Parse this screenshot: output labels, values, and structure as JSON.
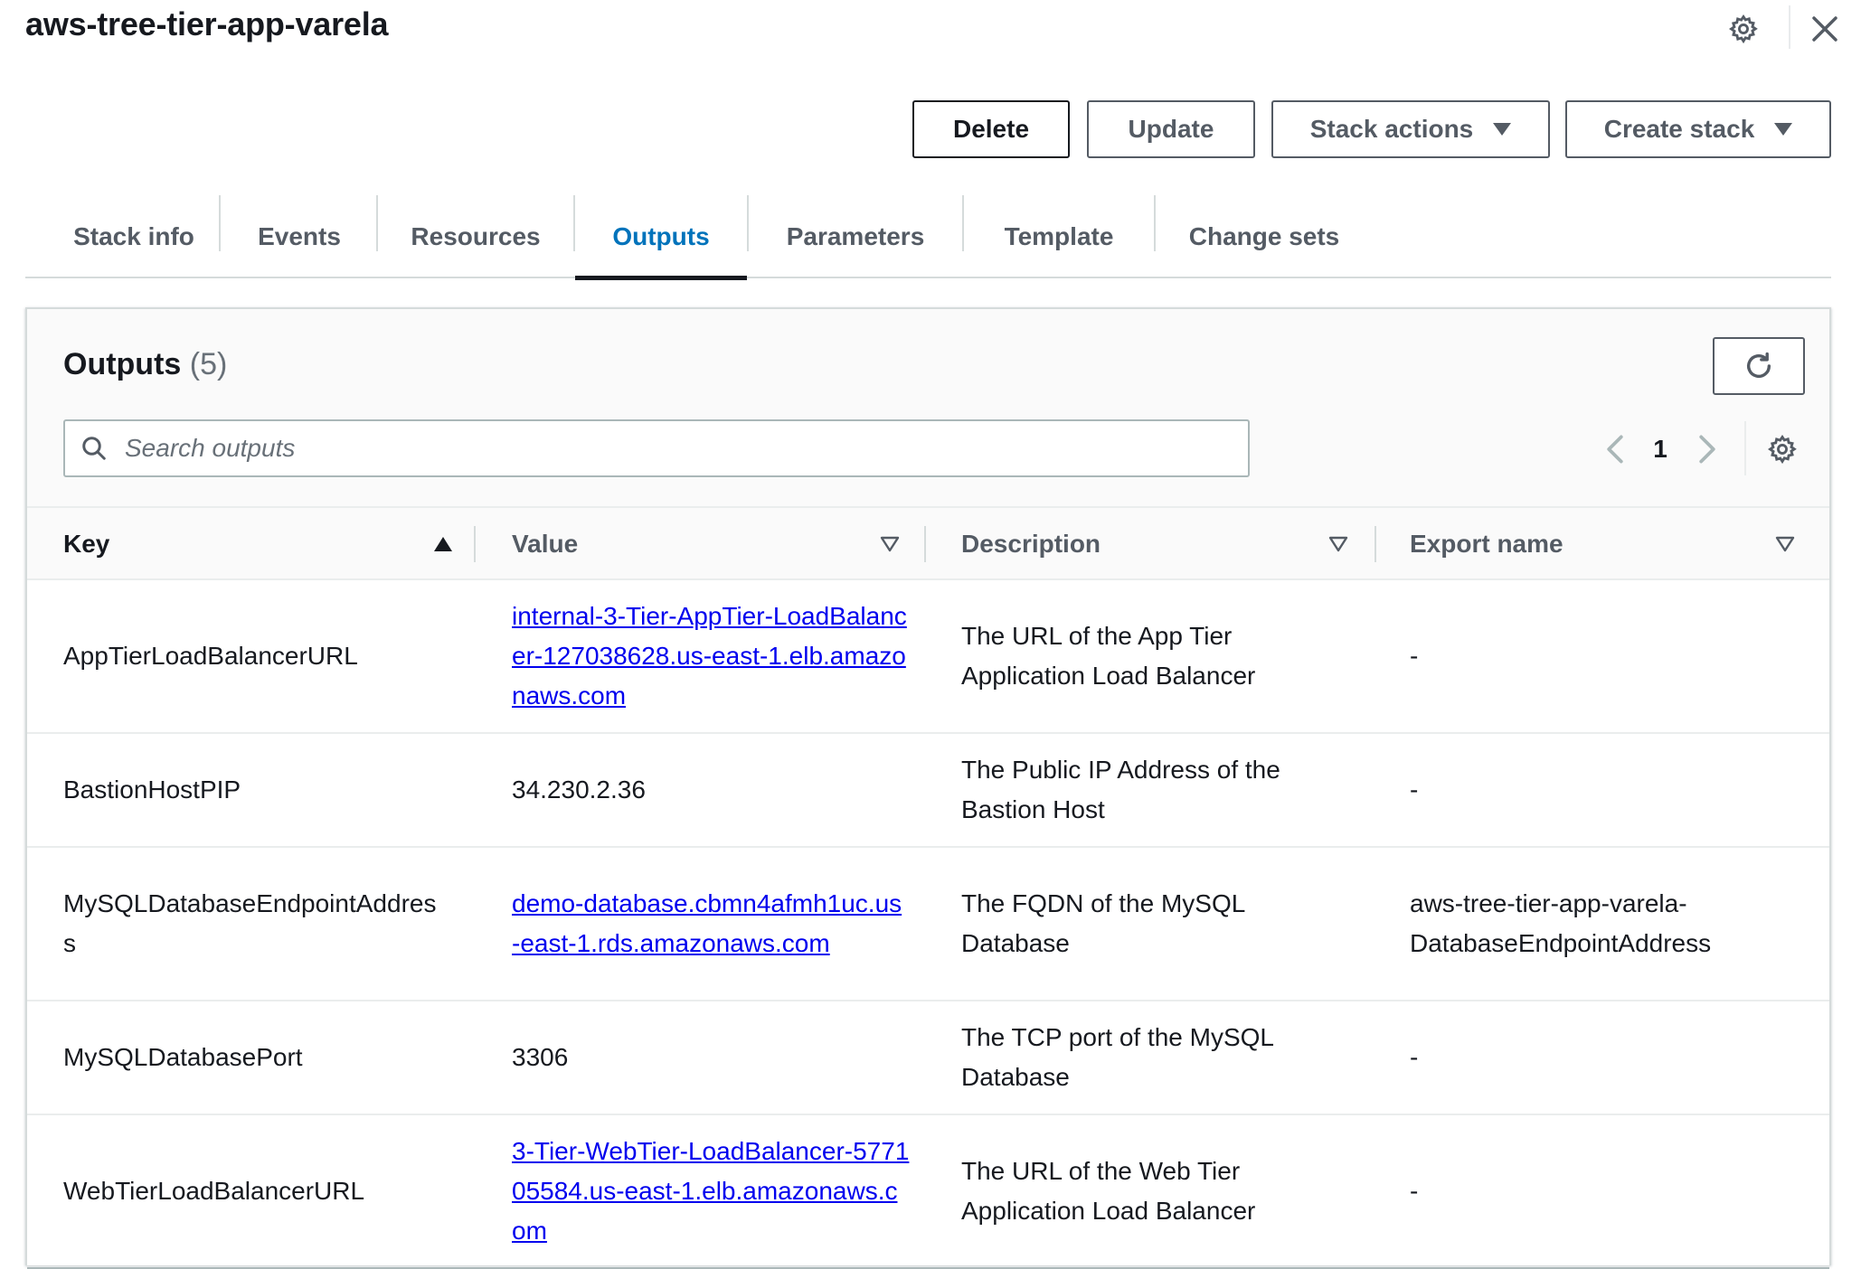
{
  "header": {
    "title": "aws-tree-tier-app-varela",
    "icons": [
      "gear-icon",
      "close-icon"
    ]
  },
  "actions": {
    "delete": "Delete",
    "update": "Update",
    "stack_actions": "Stack actions",
    "create_stack": "Create stack"
  },
  "tabs": [
    {
      "label": "Stack info"
    },
    {
      "label": "Events"
    },
    {
      "label": "Resources"
    },
    {
      "label": "Outputs",
      "active": true
    },
    {
      "label": "Parameters"
    },
    {
      "label": "Template"
    },
    {
      "label": "Change sets"
    }
  ],
  "outputs": {
    "title": "Outputs",
    "count": "(5)",
    "search_placeholder": "Search outputs",
    "search_value": "",
    "page": "1",
    "columns": {
      "key": "Key",
      "value": "Value",
      "description": "Description",
      "export_name": "Export name"
    },
    "sort": {
      "column": "Key",
      "direction": "ascending"
    },
    "rows": [
      {
        "key": "AppTierLoadBalancerURL",
        "value": "internal-3-Tier-AppTier-LoadBalancer-127038628.us-east-1.elb.amazonaws.com",
        "value_is_link": true,
        "description": "The URL of the App Tier Application Load Balancer",
        "export_name": "-"
      },
      {
        "key": "BastionHostPIP",
        "value": "34.230.2.36",
        "value_is_link": false,
        "description": "The Public IP Address of the Bastion Host",
        "export_name": "-"
      },
      {
        "key": "MySQLDatabaseEndpointAddress",
        "value": "demo-database.cbmn4afmh1uc.us-east-1.rds.amazonaws.com",
        "value_is_link": true,
        "description": "The FQDN of the MySQL Database",
        "export_name": "aws-tree-tier-app-varela-DatabaseEndpointAddress"
      },
      {
        "key": "MySQLDatabasePort",
        "value": "3306",
        "value_is_link": false,
        "description": "The TCP port of the MySQL Database",
        "export_name": "-"
      },
      {
        "key": "WebTierLoadBalancerURL",
        "value": "3-Tier-WebTier-LoadBalancer-577105584.us-east-1.elb.amazonaws.com",
        "value_is_link": true,
        "description": "The URL of the Web Tier Application Load Balancer",
        "export_name": "-"
      }
    ]
  },
  "colors": {
    "link": "#0000ee",
    "active_tab": "#0073bb",
    "text": "#16191f",
    "muted": "#545b64",
    "border": "#d5dbdb"
  }
}
